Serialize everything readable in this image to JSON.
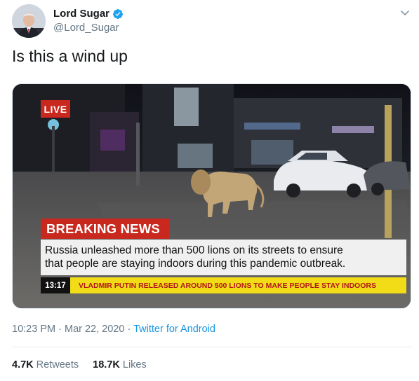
{
  "author": {
    "display_name": "Lord Sugar",
    "handle": "@Lord_Sugar"
  },
  "icons": {
    "verified": "verified-badge-icon",
    "more": "chevron-down-icon"
  },
  "tweet": {
    "text": "Is this a wind up"
  },
  "media": {
    "live_label": "LIVE",
    "breaking_label": "BREAKING NEWS",
    "headline_line1": "Russia unleashed more than 500 lions on its streets to ensure",
    "headline_line2": "that people are staying indoors during this pandemic outbreak.",
    "ticker_time": "13:17",
    "ticker_text": "VLADMIR PUTIN RELEASED AROUND 500 LIONS TO MAKE PEOPLE STAY INDOORS"
  },
  "meta": {
    "time": "10:23 PM",
    "separator": "·",
    "date": "Mar 22, 2020",
    "source": "Twitter for Android"
  },
  "stats": {
    "retweets_count": "4.7K",
    "retweets_label": "Retweets",
    "likes_count": "18.7K",
    "likes_label": "Likes"
  },
  "colors": {
    "accent": "#1b95e0",
    "breaking_red": "#c8281e",
    "ticker_yellow": "#f2dc18"
  }
}
